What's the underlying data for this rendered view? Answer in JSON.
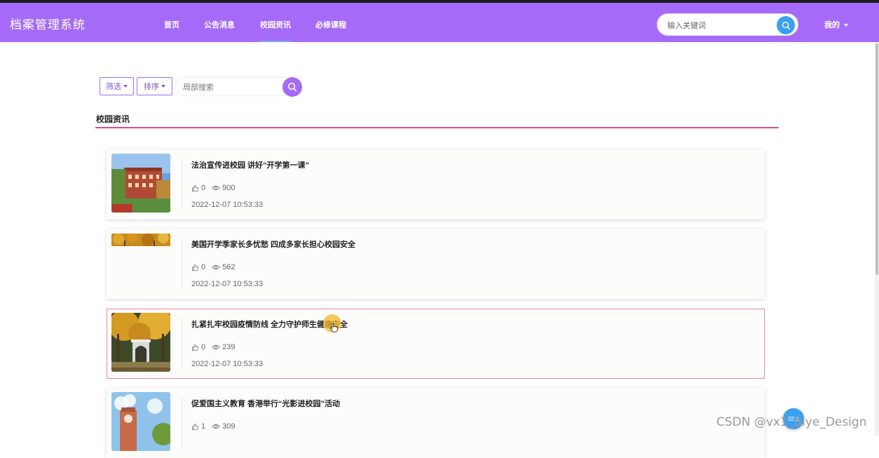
{
  "app": {
    "title": "档案管理系统"
  },
  "nav": {
    "items": [
      {
        "label": "首页"
      },
      {
        "label": "公告消息"
      },
      {
        "label": "校园资讯"
      },
      {
        "label": "必修课程"
      }
    ],
    "active_index": 2,
    "search_placeholder": "输入关键词",
    "user_menu_label": "我的"
  },
  "toolbar": {
    "filter_label": "筛选",
    "sort_label": "排序",
    "search_placeholder": "局部搜索"
  },
  "section": {
    "title": "校园资讯"
  },
  "news": [
    {
      "title": "法治宣传进校园 讲好“开学第一课”",
      "likes": "0",
      "views": "900",
      "date": "2022-12-07 10:53:33",
      "image": "red-brick-building"
    },
    {
      "title": "美国开学季家长多忧愁 四成多家长担心校园安全",
      "likes": "0",
      "views": "562",
      "date": "2022-12-07 10:53:33",
      "image": "autumn-trees-partial"
    },
    {
      "title": "扎紧扎牢校园疫情防线 全力守护师生健康安全",
      "likes": "0",
      "views": "239",
      "date": "2022-12-07 10:53:33",
      "image": "autumn-campus-gate",
      "highlighted": true
    },
    {
      "title": "促爱国主义教育 香港举行“光影进校园”活动",
      "likes": "1",
      "views": "309",
      "date": "",
      "image": "sky-clock-tower"
    }
  ],
  "float_button": {
    "label": "02:1"
  },
  "watermark": "CSDN @vx1_Biye_Design",
  "colors": {
    "navbar": "#a56bf8",
    "accent_line": "#d94c8c",
    "search_button": "#3aa0f0",
    "active_card_border": "#e386a8"
  }
}
